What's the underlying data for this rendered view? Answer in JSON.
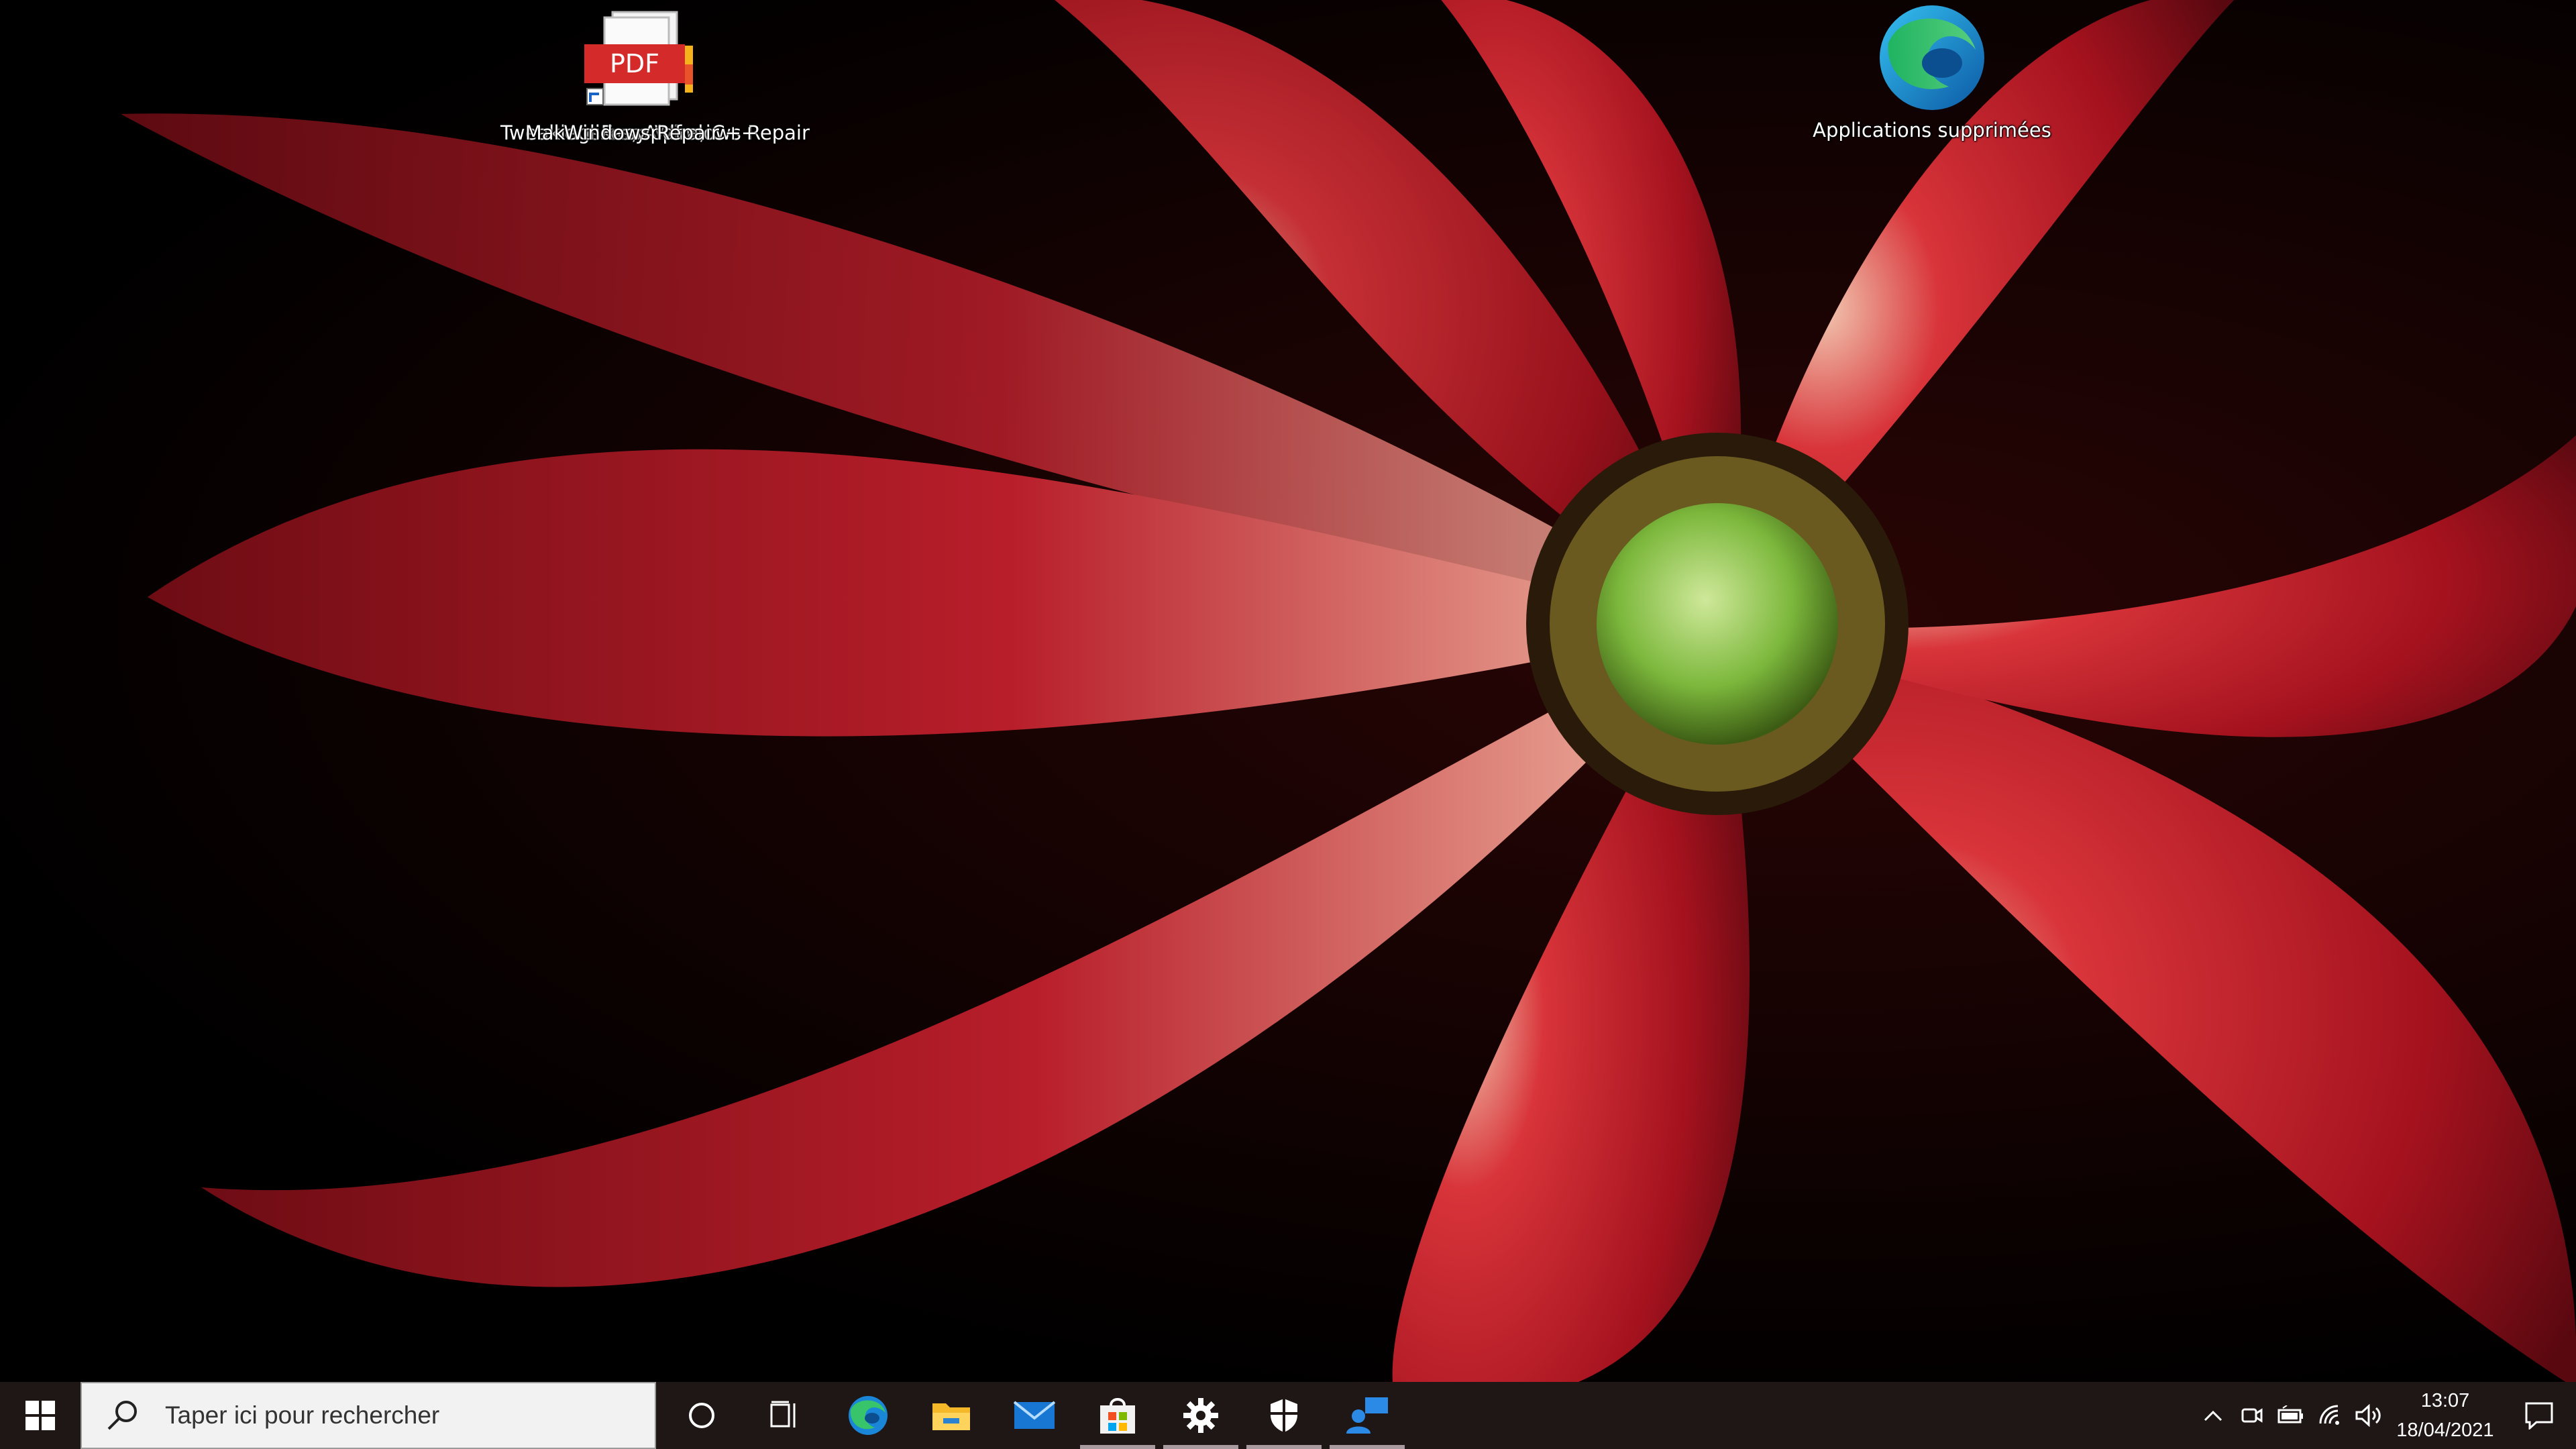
{
  "desktop": {
    "icons": [
      {
        "name": "pdf-file",
        "labels": [
          "Tweakings.com Windows Repair",
          "Make discs, Alpha, C++",
          "Easy.pdf",
          "Windows Repair"
        ]
      },
      {
        "name": "edge",
        "label": "Applications supprimées"
      }
    ]
  },
  "taskbar": {
    "search_placeholder": "Taper ici pour rechercher",
    "apps": [
      "cortana-icon",
      "task-view-icon",
      "edge-icon",
      "file-explorer-icon",
      "mail-icon",
      "store-icon",
      "settings-icon",
      "security-icon",
      "quick-assist-icon"
    ],
    "clock": {
      "time": "13:07",
      "date": "18/04/2021"
    }
  },
  "colors": {
    "taskbar": "#1f1616",
    "accent": "#a99aa0"
  }
}
